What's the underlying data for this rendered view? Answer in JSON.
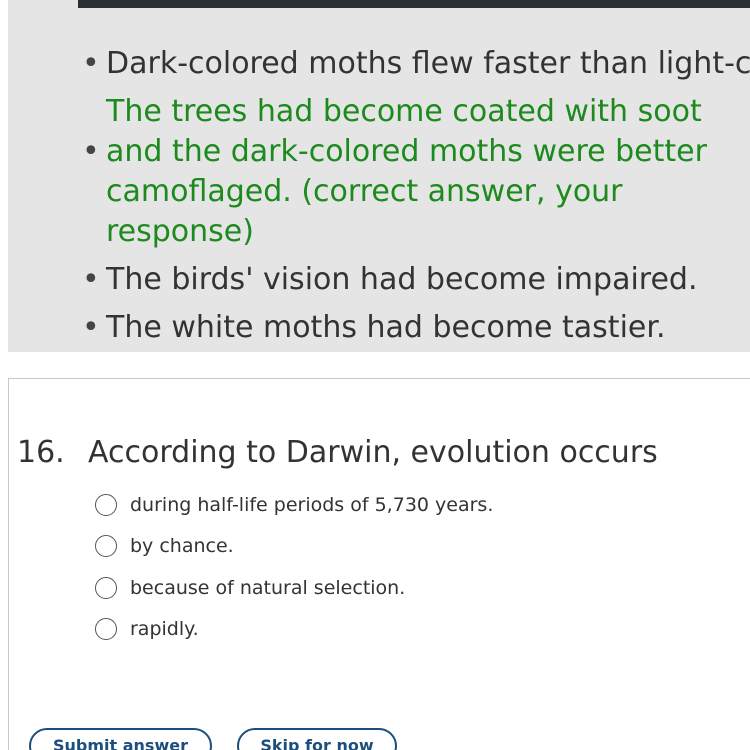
{
  "previous_question": {
    "answers": [
      {
        "text": "Dark-colored moths flew faster than light-colored moths.",
        "correct": false
      },
      {
        "text": "The trees had become coated with soot and the dark-colored moths were better camoflaged. (correct answer, your response)",
        "correct": true
      },
      {
        "text": "The birds' vision had become impaired.",
        "correct": false
      },
      {
        "text": "The white moths had become tastier.",
        "correct": false
      }
    ],
    "correct_color": "#1d8a1d"
  },
  "question": {
    "number": "16.",
    "text": "According to Darwin, evolution occurs",
    "options": [
      {
        "label": "during half-life periods of 5,730 years."
      },
      {
        "label": "by chance."
      },
      {
        "label": "because of natural selection."
      },
      {
        "label": "rapidly."
      }
    ]
  },
  "buttons": {
    "submit_label": "Submit answer",
    "skip_label": "Skip for now"
  },
  "colors": {
    "panel_bg": "#e5e5e5",
    "button_border": "#1d4f7c"
  }
}
